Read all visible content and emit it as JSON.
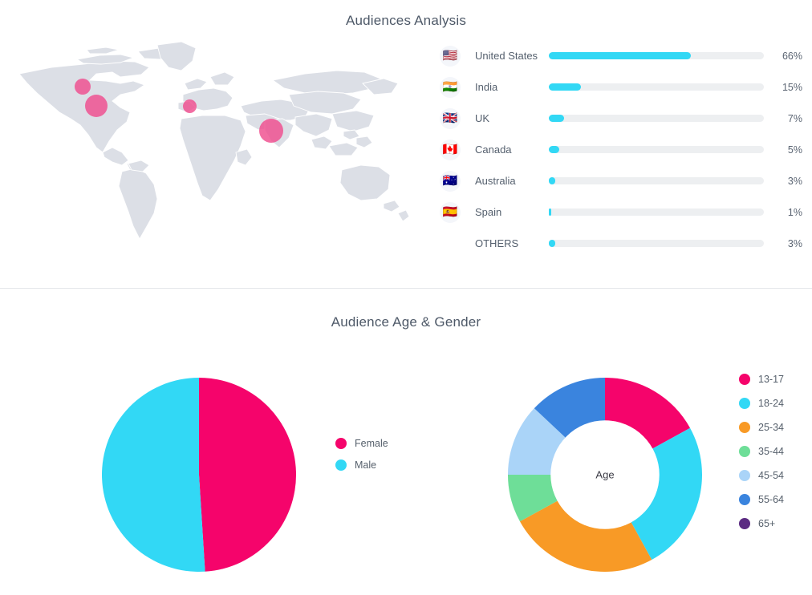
{
  "audiences": {
    "title": "Audiences Analysis",
    "countries": [
      {
        "flag": "us-flag-icon",
        "glyph": "🇺🇸",
        "name": "United States",
        "percent": 66,
        "percent_label": "66%"
      },
      {
        "flag": "in-flag-icon",
        "glyph": "🇮🇳",
        "name": "India",
        "percent": 15,
        "percent_label": "15%"
      },
      {
        "flag": "gb-flag-icon",
        "glyph": "🇬🇧",
        "name": "UK",
        "percent": 7,
        "percent_label": "7%"
      },
      {
        "flag": "ca-flag-icon",
        "glyph": "🇨🇦",
        "name": "Canada",
        "percent": 5,
        "percent_label": "5%"
      },
      {
        "flag": "au-flag-icon",
        "glyph": "🇦🇺",
        "name": "Australia",
        "percent": 3,
        "percent_label": "3%"
      },
      {
        "flag": "es-flag-icon",
        "glyph": "🇪🇸",
        "name": "Spain",
        "percent": 1,
        "percent_label": "1%"
      },
      {
        "flag": "",
        "glyph": "",
        "name": "OTHERS",
        "percent": 3,
        "percent_label": "3%"
      }
    ],
    "map": {
      "bubbles": [
        {
          "name": "canada-bubble",
          "x": 103,
          "y": 64,
          "size": 20
        },
        {
          "name": "united-states-bubble",
          "x": 120,
          "y": 88,
          "size": 28
        },
        {
          "name": "spain-bubble",
          "x": 237,
          "y": 89,
          "size": 17
        },
        {
          "name": "india-bubble",
          "x": 338,
          "y": 119,
          "size": 30
        }
      ],
      "land_color": "#dcdfe6",
      "bubble_color": "#ef4d8e"
    },
    "bar_track_color": "#edeff1",
    "bar_fill_color": "#32d8f5"
  },
  "age_gender": {
    "title": "Audience Age & Gender"
  },
  "chart_data": [
    {
      "type": "pie",
      "title": "Audience Gender",
      "categories": [
        "Female",
        "Male"
      ],
      "values": [
        49,
        51
      ],
      "colors": [
        "#f5046b",
        "#32d8f5"
      ],
      "legend_position": "right",
      "start_angle_deg": 0
    },
    {
      "type": "pie",
      "subtype": "donut",
      "title": "Audience Age",
      "center_label": "Age",
      "categories": [
        "13-17",
        "18-24",
        "25-34",
        "35-44",
        "45-54",
        "55-64",
        "65+"
      ],
      "values": [
        17,
        25,
        25,
        8,
        12,
        13,
        0
      ],
      "colors": [
        "#f5046b",
        "#32d8f5",
        "#f89a26",
        "#6ede98",
        "#aad4f8",
        "#3a84de",
        "#5b2b82"
      ],
      "legend_position": "right",
      "hole_ratio": 0.56
    },
    {
      "type": "bar",
      "subtype": "horizontal-progress",
      "title": "Audiences Analysis",
      "categories": [
        "United States",
        "India",
        "UK",
        "Canada",
        "Australia",
        "Spain",
        "OTHERS"
      ],
      "values": [
        66,
        15,
        7,
        5,
        3,
        1,
        3
      ],
      "xlabel": "",
      "ylabel": "",
      "xlim": [
        0,
        100
      ],
      "grid": false
    }
  ]
}
